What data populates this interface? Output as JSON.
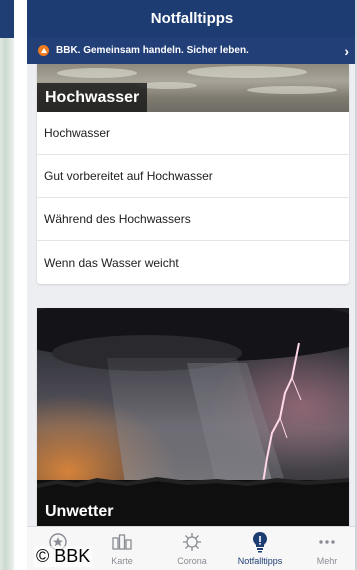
{
  "header": {
    "title": "Notfalltipps"
  },
  "banner": {
    "text": "BBK. Gemeinsam handeln. Sicher leben.",
    "chevron": "›",
    "icon": "warning-icon",
    "accent": "#f07c22"
  },
  "flood_card": {
    "title": "Hochwasser",
    "items": [
      {
        "label": "Hochwasser"
      },
      {
        "label": "Gut vorbereitet auf Hochwasser"
      },
      {
        "label": "Während des Hochwassers"
      },
      {
        "label": "Wenn das Wasser weicht"
      }
    ]
  },
  "storm_card": {
    "title": "Unwetter"
  },
  "tabbar": {
    "tabs": [
      {
        "label": "",
        "icon": "star-badge-icon",
        "active": false
      },
      {
        "label": "Karte",
        "icon": "map-icon",
        "active": false
      },
      {
        "label": "Corona",
        "icon": "virus-icon",
        "active": false
      },
      {
        "label": "Notfalltipps",
        "icon": "lightbulb-icon",
        "active": true
      },
      {
        "label": "Mehr",
        "icon": "more-dots-icon",
        "active": false
      }
    ]
  },
  "copyright": "© BBK",
  "colors": {
    "header_bg": "#1d3d72",
    "active_tab": "#1d3d72",
    "inactive_tab": "#8a8d93"
  }
}
